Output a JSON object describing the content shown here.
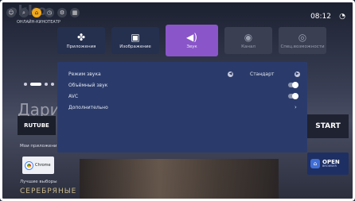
{
  "brand": {
    "logo": "okko",
    "subtitle": "ОНЛАЙН-КИНОТЕАТР"
  },
  "status": {
    "time": "08:12",
    "icons": [
      "profile-icon",
      "search-icon",
      "home-icon",
      "clock-icon",
      "settings-icon",
      "grid-icon"
    ]
  },
  "categories": [
    {
      "label": "Приложения",
      "icon": "apps-icon"
    },
    {
      "label": "Изображение",
      "icon": "picture-icon"
    },
    {
      "label": "Звук",
      "icon": "speaker-icon",
      "selected": true
    },
    {
      "label": "Канал",
      "icon": "antenna-icon"
    },
    {
      "label": "Спец.возможности",
      "icon": "accessibility-icon"
    }
  ],
  "settings": {
    "sound_mode": {
      "label": "Режим звука",
      "value": "Стандарт"
    },
    "surround": {
      "label": "Объёмный звук",
      "on": false
    },
    "avc": {
      "label": "AVC",
      "on": false
    },
    "advanced": {
      "label": "Дополнительно"
    }
  },
  "background": {
    "big_text": "Дари",
    "rutube": "RUTUBE",
    "my_apps": "Мои приложения",
    "chrome": "Chrome",
    "best": "Лучшие выборы",
    "poster_title": "СЕРЕБРЯНЫЕ",
    "start": "START",
    "open_browser": {
      "title": "OPEN",
      "sub": "BROWSER"
    }
  }
}
